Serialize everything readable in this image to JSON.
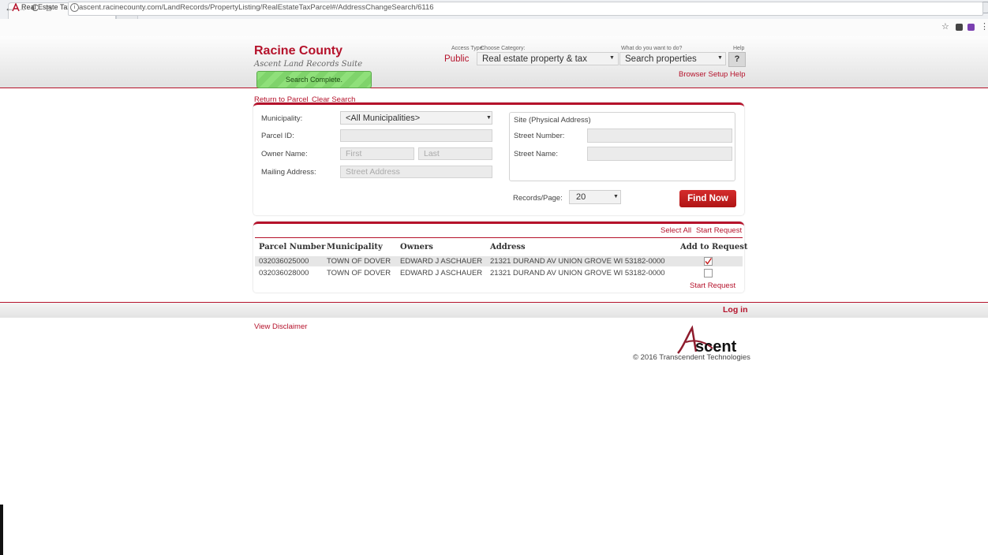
{
  "browser": {
    "tab_title": "Real Estate Tax Parcel",
    "tab_close": "×",
    "url": "ascent.racinecounty.com/LandRecords/PropertyListing/RealEstateTaxParcel#/AddressChangeSearch/6116"
  },
  "header": {
    "county": "Racine County",
    "suite": "Ascent Land Records Suite",
    "status": "Search Complete.",
    "access_type_label": "Access Type:",
    "access_type": "Public",
    "category_label": "Choose Category:",
    "category": "Real estate property & tax",
    "action_label": "What do you want to do?",
    "action": "Search properties",
    "help_label": "Help",
    "help_button": "?",
    "browser_setup": "Browser Setup Help"
  },
  "nav": {
    "return_to_parcel": "Return to Parcel",
    "clear_search": "Clear Search"
  },
  "search": {
    "municipality_label": "Municipality:",
    "municipality_value": "<All Municipalities>",
    "parcel_label": "Parcel ID:",
    "owner_label": "Owner Name:",
    "owner_first_placeholder": "First",
    "owner_last_placeholder": "Last",
    "mailing_label": "Mailing Address:",
    "mailing_placeholder": "Street Address",
    "site_title": "Site (Physical Address)",
    "street_number_label": "Street Number:",
    "street_name_label": "Street Name:",
    "records_label": "Records/Page:",
    "records_value": "20",
    "find_button": "Find Now"
  },
  "results": {
    "select_all": "Select All",
    "start_request": "Start Request",
    "columns": [
      "Parcel Number",
      "Municipality",
      "Owners",
      "Address",
      "Add to Request"
    ],
    "rows": [
      {
        "parcel": "032036025000",
        "municipality": "TOWN OF DOVER",
        "owners": "EDWARD J ASCHAUER",
        "address": "21321 DURAND AV UNION GROVE WI 53182-0000",
        "checked": true
      },
      {
        "parcel": "032036028000",
        "municipality": "TOWN OF DOVER",
        "owners": "EDWARD J ASCHAUER",
        "address": "21321 DURAND AV UNION GROVE WI 53182-0000",
        "checked": false
      }
    ]
  },
  "footer": {
    "login": "Log in",
    "disclaimer": "View Disclaimer",
    "logo_text": "scent",
    "copyright": "© 2016 Transcendent Technologies"
  },
  "colors": {
    "brand": "#b5122b",
    "status_green": "#8fe07a"
  }
}
